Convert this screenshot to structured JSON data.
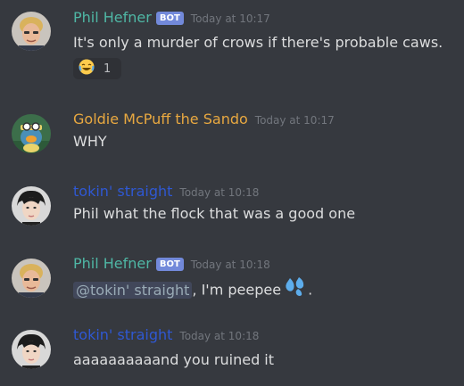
{
  "colors": {
    "background": "#36393f",
    "bot_badge": "#7289da",
    "phil_name": "#4fb7a5",
    "goldie_name": "#e8a840",
    "tokin_name": "#2f58d3",
    "timestamp": "#72767d",
    "text": "#dcddde"
  },
  "messages": [
    {
      "author": "Phil Hefner",
      "bot_badge": "BOT",
      "time": "Today at 10:17",
      "text": "It's only a murder of crows if there's probable caws.",
      "reaction": {
        "emoji": "joy-emoji",
        "count": "1"
      }
    },
    {
      "author": "Goldie McPuff the Sando",
      "time": "Today at 10:17",
      "text": "WHY"
    },
    {
      "author": "tokin' straight",
      "time": "Today at 10:18",
      "text": "Phil what the flock that was a good one"
    },
    {
      "author": "Phil Hefner",
      "bot_badge": "BOT",
      "time": "Today at 10:18",
      "mention": "@tokin' straight",
      "text_after": ", I'm peepee",
      "emoji": "sweat-drops-emoji",
      "text_end": "."
    },
    {
      "author": "tokin' straight",
      "time": "Today at 10:18",
      "text": "aaaaaaaaaand you ruined it"
    }
  ]
}
